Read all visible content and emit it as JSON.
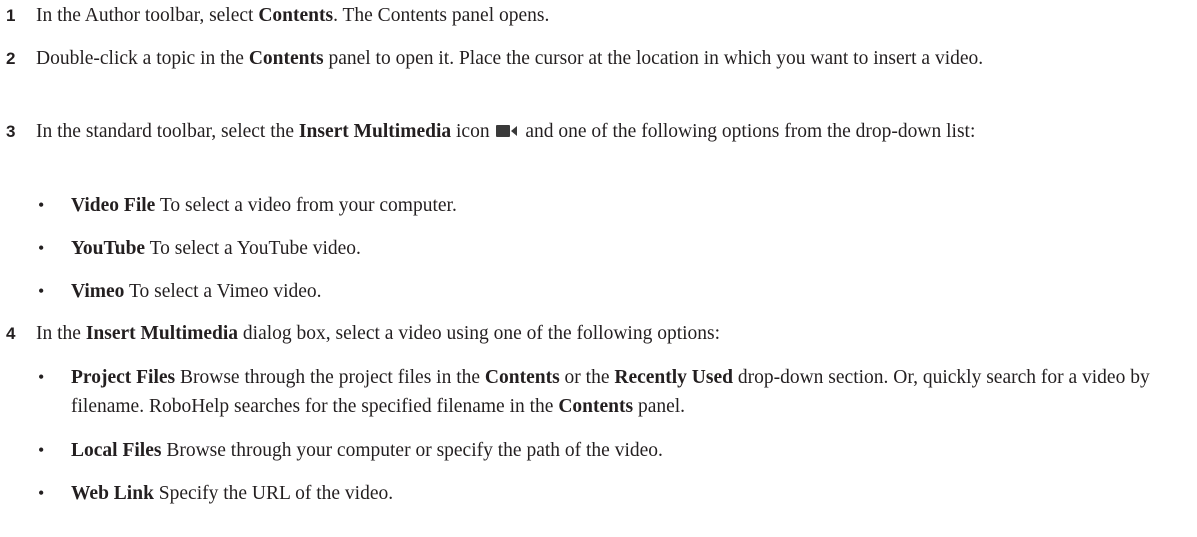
{
  "steps": [
    {
      "number": "1",
      "t1": "In the Author toolbar, select ",
      "b1": "Contents",
      "t2": ". The Contents panel opens."
    },
    {
      "number": "2",
      "t1": "Double-click a topic in the ",
      "b1": "Contents",
      "t2": " panel to open it. Place the cursor at the location in which you want to insert a video."
    },
    {
      "number": "3",
      "t1": "In the standard toolbar, select the ",
      "b1": "Insert Multimedia",
      "t2": " icon",
      "t3": " and one of the following options from the drop-down list:",
      "icon": "video-camera-icon",
      "bullets": [
        {
          "b": "Video File",
          "t": " To select a video from your computer."
        },
        {
          "b": "YouTube",
          "t": " To select a YouTube video."
        },
        {
          "b": "Vimeo",
          "t": " To select a Vimeo video."
        }
      ]
    },
    {
      "number": "4",
      "t1": "In the ",
      "b1": "Insert Multimedia",
      "t2": " dialog box, select a video using one of the following options:",
      "bullets": [
        {
          "b": "Project Files",
          "t1": " Browse through the project files in the ",
          "b2": "Contents",
          "t2": " or the ",
          "b3": "Recently Used",
          "t3": " drop-down section. Or, quickly search for a video by filename. RoboHelp searches for the specified filename in the ",
          "b4": "Contents",
          "t4": " panel."
        },
        {
          "b": "Local Files",
          "t": " Browse through your computer or specify the path of the video."
        },
        {
          "b": "Web Link",
          "t": " Specify the URL of the video."
        }
      ]
    }
  ],
  "bullet_char": "•",
  "colors": {
    "text": "#231f20",
    "icon": "#3a3a3a"
  }
}
